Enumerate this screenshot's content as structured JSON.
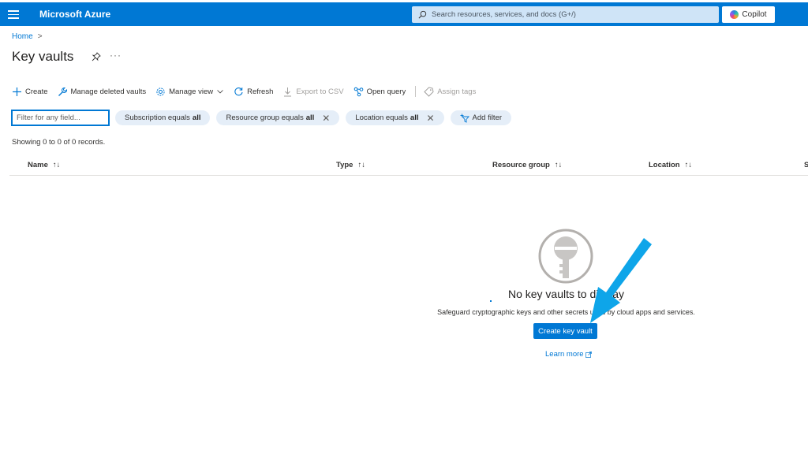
{
  "topbar": {
    "brand": "Microsoft Azure",
    "search_placeholder": "Search resources, services, and docs (G+/)",
    "copilot_label": "Copilot",
    "color": "#0078d4"
  },
  "breadcrumb": {
    "home": "Home",
    "separator": ">"
  },
  "page": {
    "title": "Key vaults",
    "more": "···"
  },
  "toolbar": {
    "create": "Create",
    "manage_deleted": "Manage deleted vaults",
    "manage_view": "Manage view",
    "refresh": "Refresh",
    "export_csv": "Export to CSV",
    "open_query": "Open query",
    "assign_tags": "Assign tags"
  },
  "filters": {
    "placeholder": "Filter for any field...",
    "subscription": {
      "label": "Subscription equals",
      "value": "all"
    },
    "resource_group": {
      "label": "Resource group equals",
      "value": "all"
    },
    "location": {
      "label": "Location equals",
      "value": "all"
    },
    "add_filter": "Add filter"
  },
  "records_text": "Showing 0 to 0 of 0 records.",
  "table": {
    "columns": [
      {
        "label": "Name",
        "sort": "↑↓"
      },
      {
        "label": "Type",
        "sort": "↑↓"
      },
      {
        "label": "Resource group",
        "sort": "↑↓"
      },
      {
        "label": "Location",
        "sort": "↑↓"
      },
      {
        "label": "S"
      }
    ]
  },
  "empty_state": {
    "title": "No key vaults to display",
    "subtitle": "Safeguard cryptographic keys and other secrets used by cloud apps and services.",
    "button": "Create key vault",
    "learn_more": "Learn more",
    "icon": "key-icon"
  },
  "annotation": {
    "arrow_color": "#0ea5e9",
    "icon": "arrow-pointer"
  }
}
